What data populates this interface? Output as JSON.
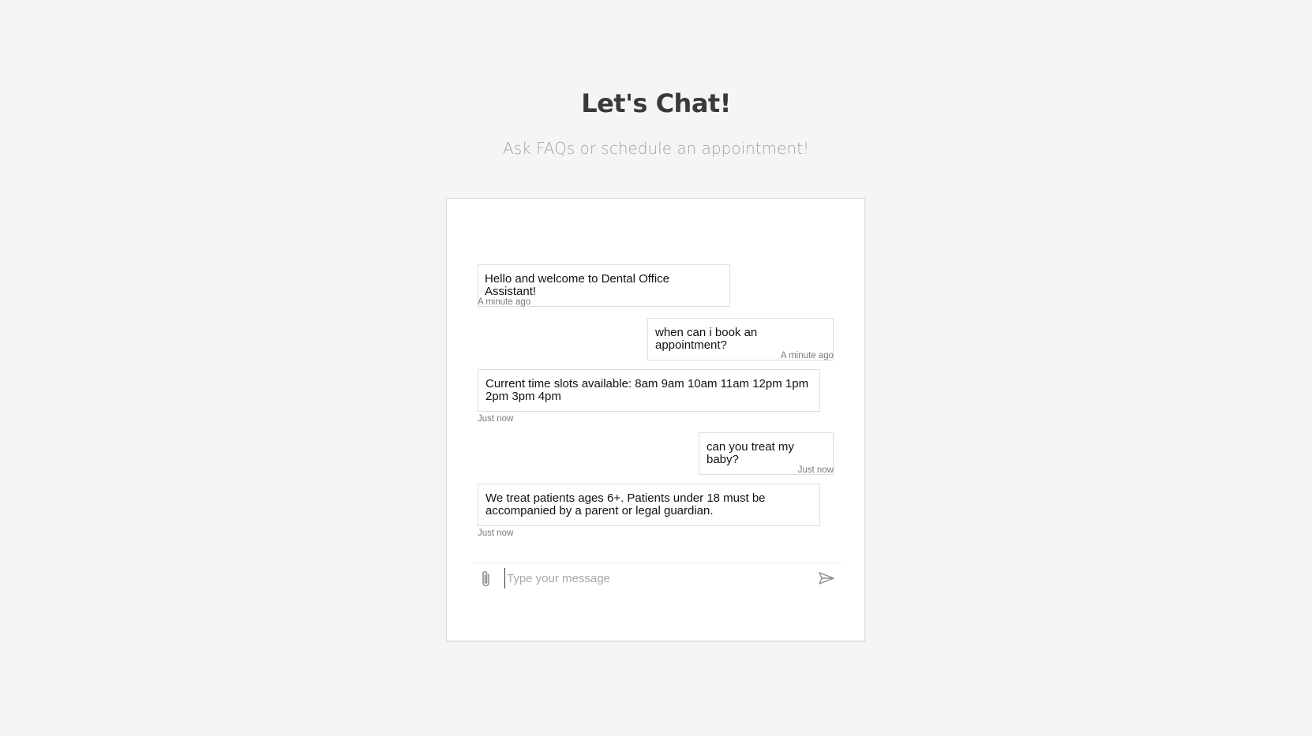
{
  "header": {
    "title": "Let's Chat!",
    "subtitle": "Ask FAQs or schedule an appointment!"
  },
  "chat": {
    "messages": [
      {
        "sender": "bot",
        "text": "Hello and welcome to Dental Office Assistant!",
        "time": "A minute ago"
      },
      {
        "sender": "user",
        "text": "when can i book an appointment?",
        "time": "A minute ago"
      },
      {
        "sender": "bot",
        "text": "Current time slots available: 8am 9am 10am 11am 12pm 1pm 2pm 3pm 4pm",
        "time": "Just now"
      },
      {
        "sender": "user",
        "text": "can you treat my baby?",
        "time": "Just now"
      },
      {
        "sender": "bot",
        "text": "We treat patients ages 6+. Patients under 18 must be accompanied by a parent or legal guardian.",
        "time": "Just now"
      }
    ],
    "composer": {
      "placeholder": "Type your message",
      "value": "",
      "attach_icon": "paperclip-icon",
      "send_icon": "send-icon"
    }
  },
  "colors": {
    "background": "#f5f5f4",
    "title": "#3a3a3a",
    "subtitle": "#a3a3a3",
    "card": "#ffffff",
    "bubble_border": "#dedede",
    "timestamp": "#7a7a7a"
  }
}
